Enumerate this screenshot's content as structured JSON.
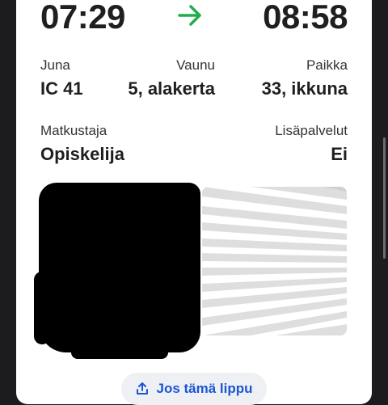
{
  "ticket": {
    "departure_time": "07:29",
    "arrival_time": "08:58",
    "arrow_icon": "arrow-right-icon",
    "accent_color": "#1fae4b",
    "train_label": "Juna",
    "train_value": "IC 41",
    "car_label": "Vaunu",
    "car_value": "5, alakerta",
    "seat_label": "Paikka",
    "seat_value": "33, ikkuna",
    "passenger_label": "Matkustaja",
    "passenger_value": "Opiskelija",
    "extras_label": "Lisäpalvelut",
    "extras_value": "Ei",
    "action_button_label": "Jos tämä lippu",
    "action_button_color": "#1a56d6"
  }
}
